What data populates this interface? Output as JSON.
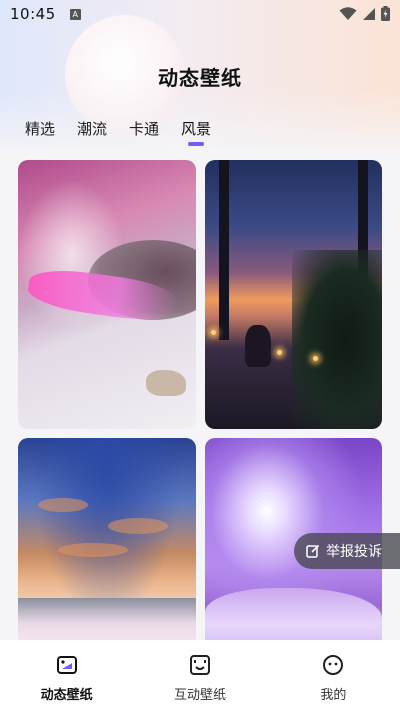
{
  "statusbar": {
    "time": "10:45",
    "notification_glyph": "A"
  },
  "header": {
    "title": "动态壁纸"
  },
  "tabs": [
    {
      "label": "精选",
      "active": false
    },
    {
      "label": "潮流",
      "active": false
    },
    {
      "label": "卡通",
      "active": false
    },
    {
      "label": "风景",
      "active": true
    }
  ],
  "wallpapers": [
    {
      "name": "snowy-pink-river"
    },
    {
      "name": "night-window-girl"
    },
    {
      "name": "sunset-cloud-field"
    },
    {
      "name": "purple-galaxy-hill"
    }
  ],
  "report_button": {
    "label": "举报投诉",
    "icon": "edit-icon"
  },
  "bottom_nav": [
    {
      "label": "动态壁纸",
      "icon": "wallpaper-icon",
      "active": true
    },
    {
      "label": "互动壁纸",
      "icon": "interactive-icon",
      "active": false
    },
    {
      "label": "我的",
      "icon": "profile-icon",
      "active": false
    }
  ],
  "colors": {
    "accent": "#7b5bf0",
    "bottom_bar": "#ffffff",
    "report_bg": "#46464f"
  }
}
